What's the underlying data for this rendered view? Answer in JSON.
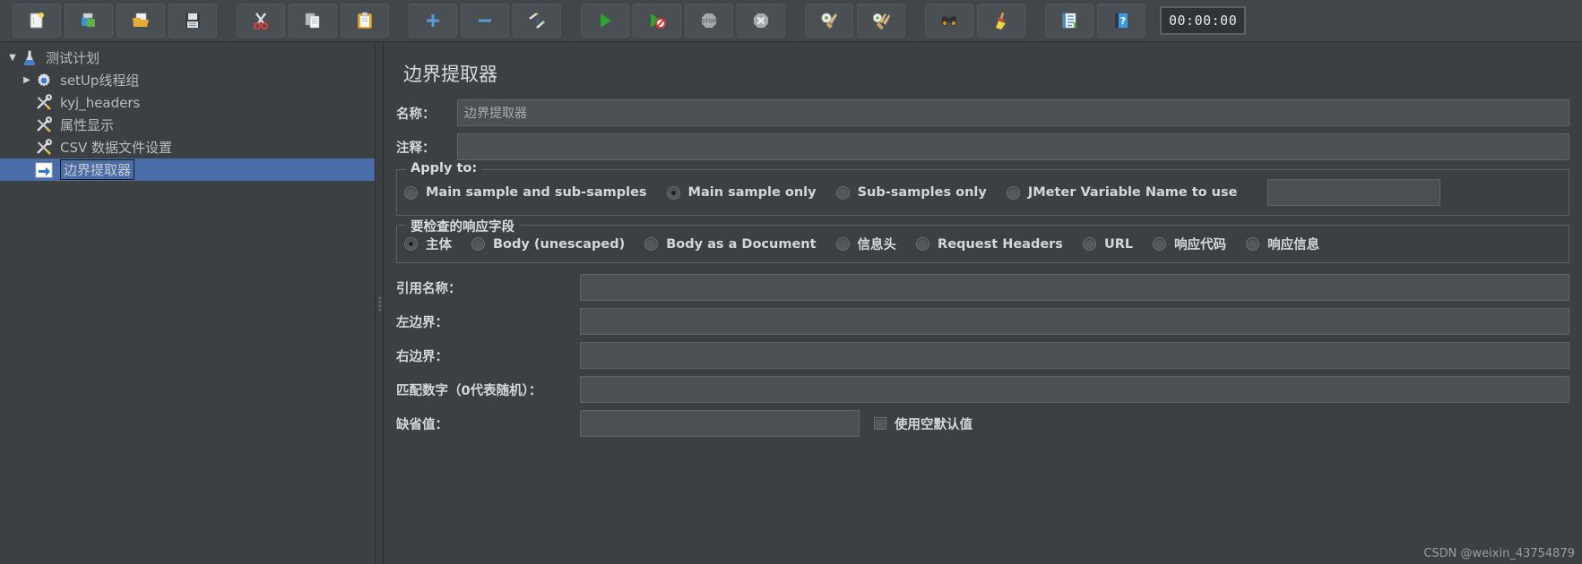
{
  "toolbar": {
    "buttons": [
      {
        "name": "new-test-plan",
        "icon": "new-document-icon",
        "tooltip": "New"
      },
      {
        "name": "templates",
        "icon": "templates-folders-icon",
        "tooltip": "Templates"
      },
      {
        "name": "open",
        "icon": "open-folder-icon",
        "tooltip": "Open"
      },
      {
        "name": "save",
        "icon": "floppy-disk-save-icon",
        "tooltip": "Save"
      },
      {
        "name": "cut",
        "icon": "scissors-cut-icon",
        "tooltip": "Cut"
      },
      {
        "name": "copy",
        "icon": "copy-pages-icon",
        "tooltip": "Copy"
      },
      {
        "name": "paste",
        "icon": "clipboard-paste-icon",
        "tooltip": "Paste"
      },
      {
        "name": "expand-all",
        "icon": "plus-icon",
        "tooltip": "Expand All"
      },
      {
        "name": "collapse-all",
        "icon": "minus-icon",
        "tooltip": "Collapse All"
      },
      {
        "name": "toggle",
        "icon": "toggle-pencils-icon",
        "tooltip": "Toggle"
      },
      {
        "name": "start",
        "icon": "green-play-icon",
        "tooltip": "Start"
      },
      {
        "name": "start-no-pauses",
        "icon": "green-play-nopause-icon",
        "tooltip": "Start no pauses"
      },
      {
        "name": "stop",
        "icon": "stop-sign-icon",
        "tooltip": "Stop"
      },
      {
        "name": "shutdown",
        "icon": "shutdown-x-icon",
        "tooltip": "Shutdown"
      },
      {
        "name": "clear",
        "icon": "gear-broom-icon",
        "tooltip": "Clear"
      },
      {
        "name": "clear-all",
        "icon": "gear-brooms-icon",
        "tooltip": "Clear All"
      },
      {
        "name": "search",
        "icon": "binoculars-icon",
        "tooltip": "Search"
      },
      {
        "name": "reset-search",
        "icon": "broom-icon",
        "tooltip": "Reset Search"
      },
      {
        "name": "function-helper",
        "icon": "list-notes-icon",
        "tooltip": "Function Helper Dialog"
      },
      {
        "name": "help",
        "icon": "help-book-icon",
        "tooltip": "Help"
      }
    ],
    "timer": "00:00:00"
  },
  "tree": {
    "items": [
      {
        "label": "测试计划",
        "icon": "flask-icon",
        "depth": 0,
        "twisty": "▼",
        "selected": false
      },
      {
        "label": "setUp线程组",
        "icon": "gear-icon",
        "depth": 1,
        "twisty": "▶",
        "selected": false
      },
      {
        "label": "kyj_headers",
        "icon": "wrench-icon",
        "depth": 1,
        "twisty": "",
        "selected": false
      },
      {
        "label": "属性显示",
        "icon": "wrench-icon",
        "depth": 1,
        "twisty": "",
        "selected": false
      },
      {
        "label": "CSV 数据文件设置",
        "icon": "wrench-icon",
        "depth": 1,
        "twisty": "",
        "selected": false
      },
      {
        "label": "边界提取器",
        "icon": "blue-arrow-icon",
        "depth": 1,
        "twisty": "",
        "selected": true
      }
    ]
  },
  "panel": {
    "title": "边界提取器",
    "name_label": "名称：",
    "name_value": "边界提取器",
    "comment_label": "注释：",
    "comment_value": "",
    "apply_to": {
      "title": "Apply to:",
      "options": [
        {
          "label": "Main sample and sub-samples",
          "checked": false
        },
        {
          "label": "Main sample only",
          "checked": true
        },
        {
          "label": "Sub-samples only",
          "checked": false
        },
        {
          "label": "JMeter Variable Name to use",
          "checked": false
        }
      ],
      "variable_value": ""
    },
    "response_field": {
      "title": "要检查的响应字段",
      "options": [
        {
          "label": "主体",
          "checked": true
        },
        {
          "label": "Body (unescaped)",
          "checked": false
        },
        {
          "label": "Body as a Document",
          "checked": false
        },
        {
          "label": "信息头",
          "checked": false
        },
        {
          "label": "Request Headers",
          "checked": false
        },
        {
          "label": "URL",
          "checked": false
        },
        {
          "label": "响应代码",
          "checked": false
        },
        {
          "label": "响应信息",
          "checked": false
        }
      ]
    },
    "fields": [
      {
        "label": "引用名称：",
        "value": "",
        "name": "reference-name"
      },
      {
        "label": "左边界：",
        "value": "",
        "name": "left-boundary"
      },
      {
        "label": "右边界：",
        "value": "",
        "name": "right-boundary"
      },
      {
        "label": "匹配数字（0代表随机）：",
        "value": "",
        "name": "match-number"
      }
    ],
    "default_row": {
      "label": "缺省值：",
      "value": "",
      "checkbox_label": "使用空默认值",
      "checkbox_checked": false
    }
  },
  "watermark": "CSDN @weixin_43754879"
}
